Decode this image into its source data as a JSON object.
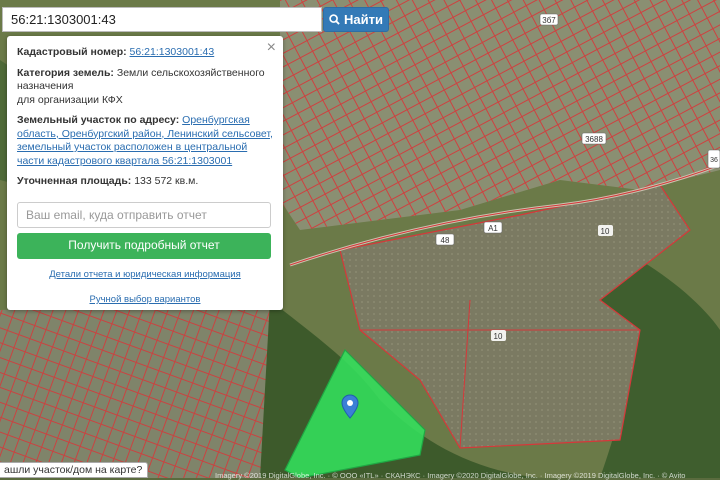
{
  "search": {
    "value": "56:21:1303001:43",
    "button_label": "Найти"
  },
  "info": {
    "cadastral_label": "Кадастровый номер:",
    "cadastral_value": "56:21:1303001:43",
    "category_label": "Категория земель:",
    "category_value": "Земли сельскохозяйственного назначения",
    "category_value2": "для организации КФХ",
    "address_label": "Земельный участок по адресу:",
    "address_value": "Оренбургская область, Оренбургский район, Ленинский сельсовет, земельный участок расположен в центральной части кадастрового квартала 56:21:1303001",
    "area_label": "Уточненная площадь:",
    "area_value": "133 572 кв.м.",
    "email_placeholder": "Ваш email, куда отправить отчет",
    "get_report_label": "Получить подробный отчет",
    "details_link": "Детали отчета и юридическая информация",
    "manual_link": "Ручной выбор вариантов"
  },
  "map_labels": {
    "road_48": "48",
    "road_a1": "А1",
    "plot_10a": "10",
    "plot_10b": "10",
    "plot_3688": "3688",
    "plot_36": "36",
    "plot_367": "3б7"
  },
  "bottom_question": "ашли участок/дом на карте?",
  "attribution": "Imagery ©2019 DigitalGlobe, Inc. · © OOO «ITL» · СКАНЭКС · Imagery ©2020 DigitalGlobe, Inc. · Imagery ©2019 DigitalGlobe, Inc. · © Avito"
}
